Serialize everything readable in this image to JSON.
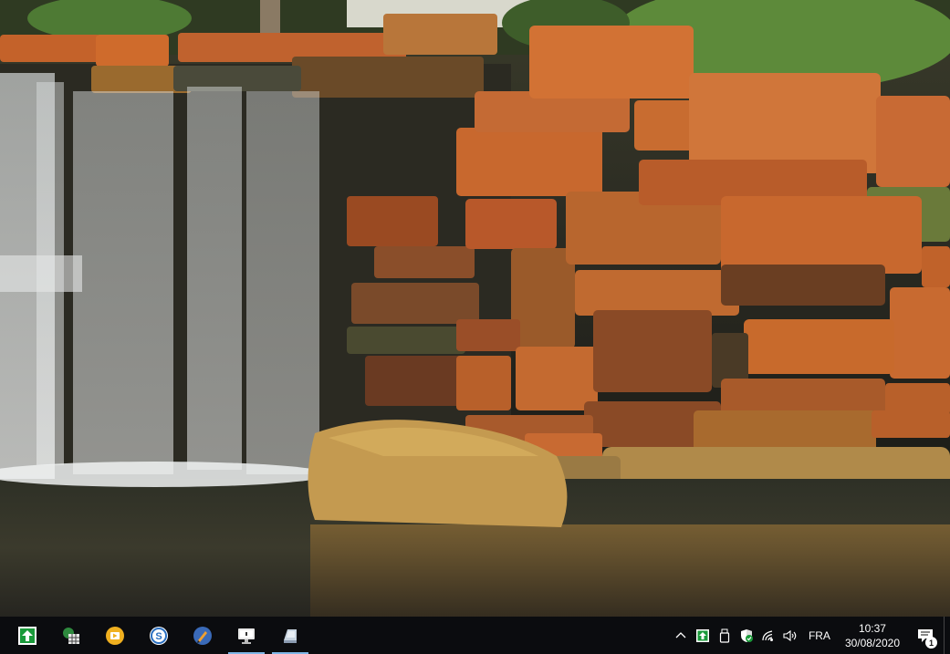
{
  "desktop": {
    "wallpaper": "waterfall-rocks"
  },
  "taskbar": {
    "apps": [
      {
        "name": "green-home-app-icon",
        "active": false
      },
      {
        "name": "spreadsheet-app-icon",
        "active": false
      },
      {
        "name": "media-player-icon",
        "active": false
      },
      {
        "name": "s-app-icon",
        "active": false
      },
      {
        "name": "pen-app-icon",
        "active": false
      },
      {
        "name": "monitor-app-icon",
        "active": true
      },
      {
        "name": "disk-app-icon",
        "active": true
      }
    ],
    "tray": {
      "language": "FRA",
      "time": "10:37",
      "date": "30/08/2020",
      "notification_count": "1"
    }
  }
}
